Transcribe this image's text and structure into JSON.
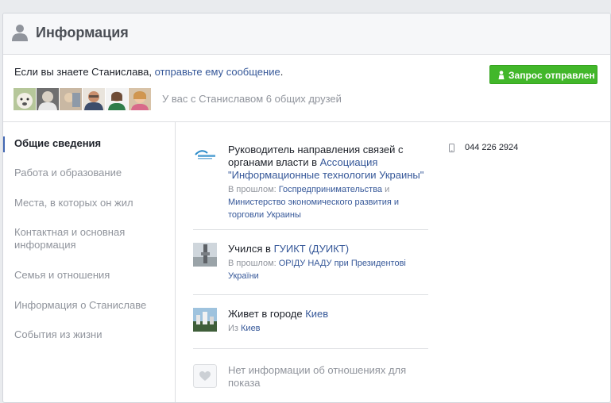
{
  "header": {
    "title": "Информация",
    "icon": "user-silhouette-icon"
  },
  "friend_request": {
    "message_prefix": "Если вы знаете Станислава, ",
    "message_link": "отправьте ему сообщение",
    "message_suffix": ".",
    "button_label": "Запрос отправлен",
    "button_icon": "person-icon",
    "mutual_friends_text": "У вас с Станиславом 6 общих друзей",
    "accent_color": "#42b72a"
  },
  "sidebar": {
    "items": [
      {
        "label": "Общие сведения",
        "active": true
      },
      {
        "label": "Работа и образование",
        "active": false
      },
      {
        "label": "Места, в которых он жил",
        "active": false
      },
      {
        "label": "Контактная и основная информация",
        "active": false
      },
      {
        "label": "Семья и отношения",
        "active": false
      },
      {
        "label": "Информация о Станиславе",
        "active": false
      },
      {
        "label": "События из жизни",
        "active": false
      }
    ]
  },
  "overview": {
    "work": {
      "title_prefix": "Руководитель направления связей с органами власти в ",
      "title_link": "Ассоциация \"Информационные технологии Украины\"",
      "past_label": "В прошлом: ",
      "past_link1": "Госпредпринимательства",
      "past_and": " и ",
      "past_link2": "Министерство экономического развития и торговли Украины"
    },
    "education": {
      "title_prefix": "Учился в ",
      "title_link": "ГУИКТ (ДУИКТ)",
      "past_label": "В прошлом: ",
      "past_link": "ОРІДУ НАДУ при Президентові України"
    },
    "current_city": {
      "title_prefix": "Живет в городе ",
      "title_link": "Киев",
      "from_label": "Из ",
      "from_link": "Киев"
    },
    "relationship": {
      "text": "Нет информации об отношениях для показа",
      "icon": "heart-icon"
    },
    "phone": {
      "number": "044 226 2924",
      "icon": "mobile-phone-icon"
    }
  }
}
